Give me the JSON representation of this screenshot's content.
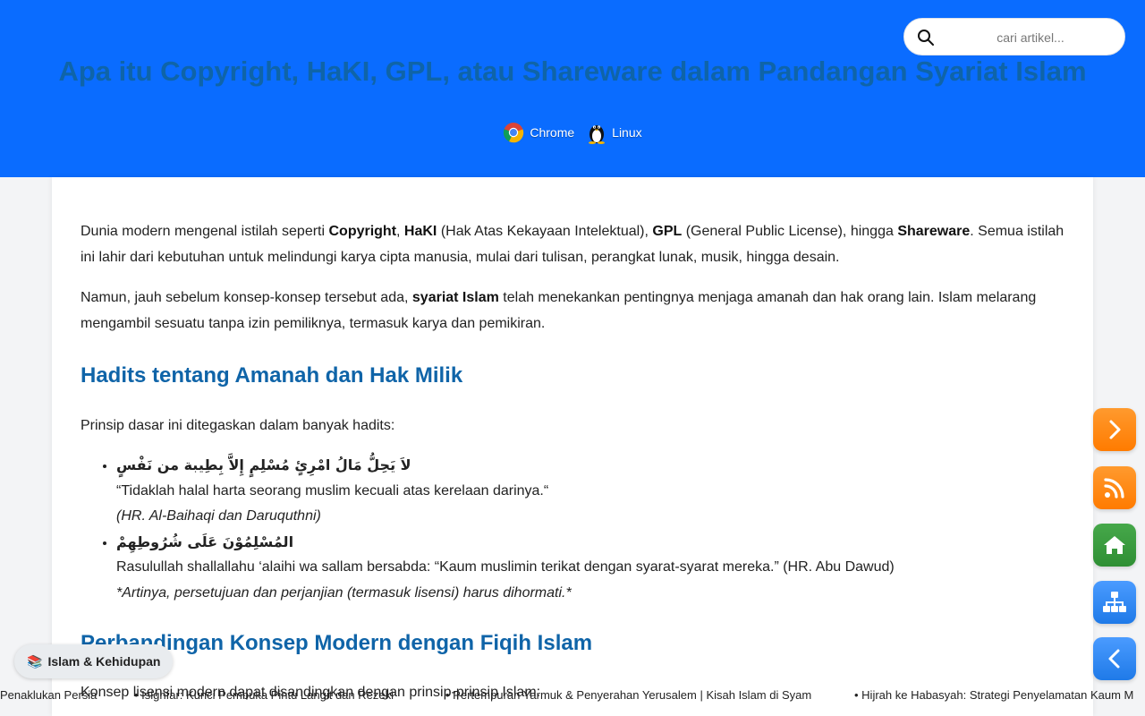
{
  "header": {
    "title": "Apa itu Copyright, HaKI, GPL, atau Shareware dalam Pandangan Syariat Islam",
    "search_placeholder": "cari artikel...",
    "platforms": [
      "Chrome",
      "Linux"
    ]
  },
  "article": {
    "p1": {
      "t1": "Dunia modern mengenal istilah seperti ",
      "b1": "Copyright",
      "t2": ", ",
      "b2": "HaKI",
      "t3": " (Hak Atas Kekayaan Intelektual), ",
      "b3": "GPL",
      "t4": " (General Public License), hingga ",
      "b4": "Shareware",
      "t5": ". Semua istilah ini lahir dari kebutuhan untuk melindungi karya cipta manusia, mulai dari tulisan, perangkat lunak, musik, hingga desain."
    },
    "p2": {
      "t1": "Namun, jauh sebelum konsep-konsep tersebut ada, ",
      "b1": "syariat Islam",
      "t2": " telah menekankan pentingnya menjaga amanah dan hak orang lain. Islam melarang mengambil sesuatu tanpa izin pemiliknya, termasuk karya dan pemikiran."
    },
    "h2_1": "Hadits tentang Amanah dan Hak Milik",
    "p3": "Prinsip dasar ini ditegaskan dalam banyak hadits:",
    "hadiths": [
      {
        "arabic": "لاَ يَحِلُّ مَالُ امْرِئٍ مُسْلِمٍ إِلاَّ بِطِيبة من نَفْسٍ",
        "translation": "“Tidaklah halal harta seorang muslim kecuali atas kerelaan darinya.“",
        "source": "(HR. Al-Baihaqi dan Daruquthni)"
      },
      {
        "arabic": "المُسْلِمُوْنَ عَلَى شُرُوطِهِمْ",
        "translation": "Rasulullah shallallahu ‘alaihi wa sallam bersabda: “Kaum muslimin terikat dengan syarat-syarat mereka.” (HR. Abu Dawud)",
        "source": "*Artinya, persetujuan dan perjanjian (termasuk lisensi) harus dihormati.*"
      }
    ],
    "h2_2": "Perbandingan Konsep Modern dengan Fiqih Islam",
    "p4": "Konsep lisensi modern dapat disandingkan dengan prinsip-prinsip Islam:"
  },
  "category_chip": {
    "emoji": "📚",
    "label": "Islam & Kehidupan"
  },
  "ticker": [
    "Penaklukan Persia",
    "• Isighfar: Kunci Pembuka Pintu Langit dan Rezeki",
    "• Pertempuran Yarmuk & Penyerahan Yerusalem | Kisah Islam di Syam",
    "• Hijrah ke Habasyah: Strategi Penyelamatan Kaum M"
  ],
  "colors": {
    "header_bg": "#0a6cff",
    "heading": "#0f64a8",
    "fab_orange": "#ff8c1a",
    "fab_green": "#3a9b3f",
    "fab_blue": "#2f86f0"
  },
  "fab_icons": [
    "chevron-right-icon",
    "rss-icon",
    "home-icon",
    "sitemap-icon",
    "chevron-left-icon"
  ]
}
